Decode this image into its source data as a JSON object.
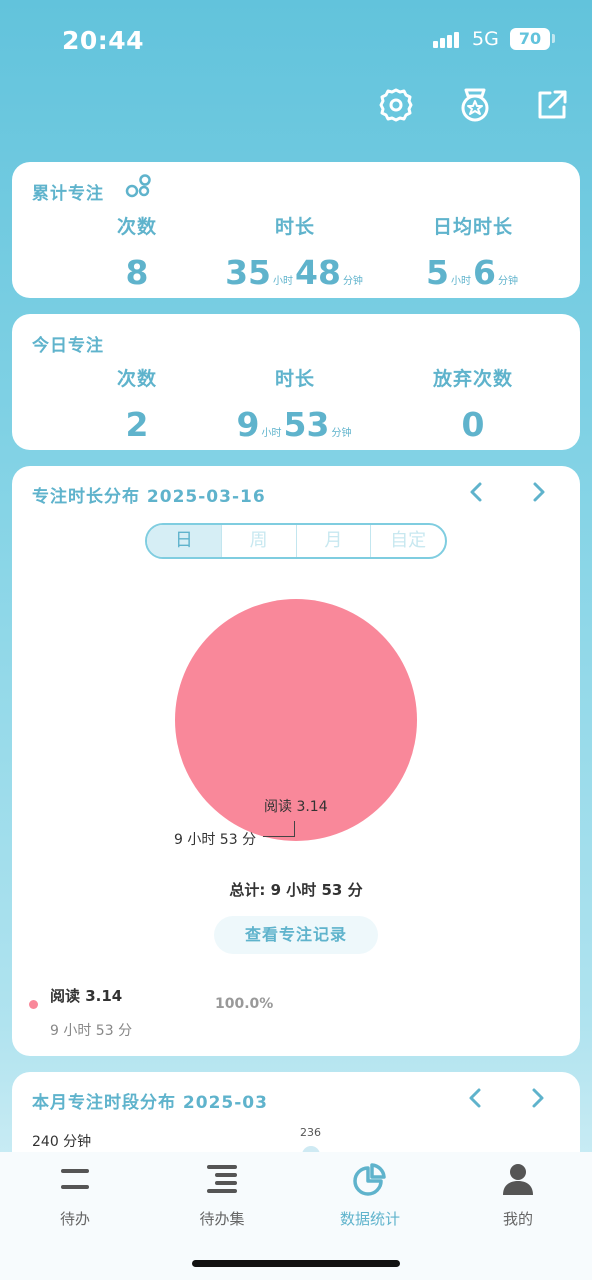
{
  "status": {
    "time": "20:44",
    "network": "5G",
    "battery": "70"
  },
  "top_icons": [
    "settings-icon",
    "medal-icon",
    "share-icon"
  ],
  "cumulative": {
    "title": "累计专注",
    "icon": "bubbles-icon",
    "count_label": "次数",
    "count_value": "8",
    "duration_label": "时长",
    "duration_hours": "35",
    "duration_hours_unit": "小时",
    "duration_minutes": "48",
    "duration_minutes_unit": "分钟",
    "daily_label": "日均时长",
    "daily_hours": "5",
    "daily_hours_unit": "小时",
    "daily_minutes": "6",
    "daily_minutes_unit": "分钟"
  },
  "today": {
    "title": "今日专注",
    "count_label": "次数",
    "count_value": "2",
    "duration_label": "时长",
    "duration_hours": "9",
    "duration_hours_unit": "小时",
    "duration_minutes": "53",
    "duration_minutes_unit": "分钟",
    "abandon_label": "放弃次数",
    "abandon_value": "0"
  },
  "distribution": {
    "title": "专注时长分布 2025-03-16",
    "segments": [
      "日",
      "周",
      "月",
      "自定"
    ],
    "selected_segment": "日",
    "pie_name_label": "阅读 3.14",
    "pie_value_label": "9 小时 53 分",
    "total": "总计: 9 小时 53 分",
    "record_button": "查看专注记录",
    "legend": [
      {
        "name": "阅读 3.14",
        "duration": "9 小时 53 分",
        "percent": "100.0%",
        "color": "#f9889a"
      }
    ]
  },
  "chart_data": {
    "type": "pie",
    "categories": [
      "阅读 3.14"
    ],
    "values": [
      100.0
    ],
    "labels": [
      "9 小时 53 分"
    ],
    "colors": [
      "#f9889a"
    ]
  },
  "monthly": {
    "title": "本月专注时段分布 2025-03",
    "y_label": "240 分钟",
    "bar_value": "236"
  },
  "tabs": [
    {
      "label": "待办",
      "icon": "menu-lines-icon"
    },
    {
      "label": "待办集",
      "icon": "list-stack-icon"
    },
    {
      "label": "数据统计",
      "icon": "pie-chart-icon",
      "active": true
    },
    {
      "label": "我的",
      "icon": "user-icon"
    }
  ],
  "colors": {
    "accent": "#5fb3cc",
    "pie": "#f9889a"
  }
}
